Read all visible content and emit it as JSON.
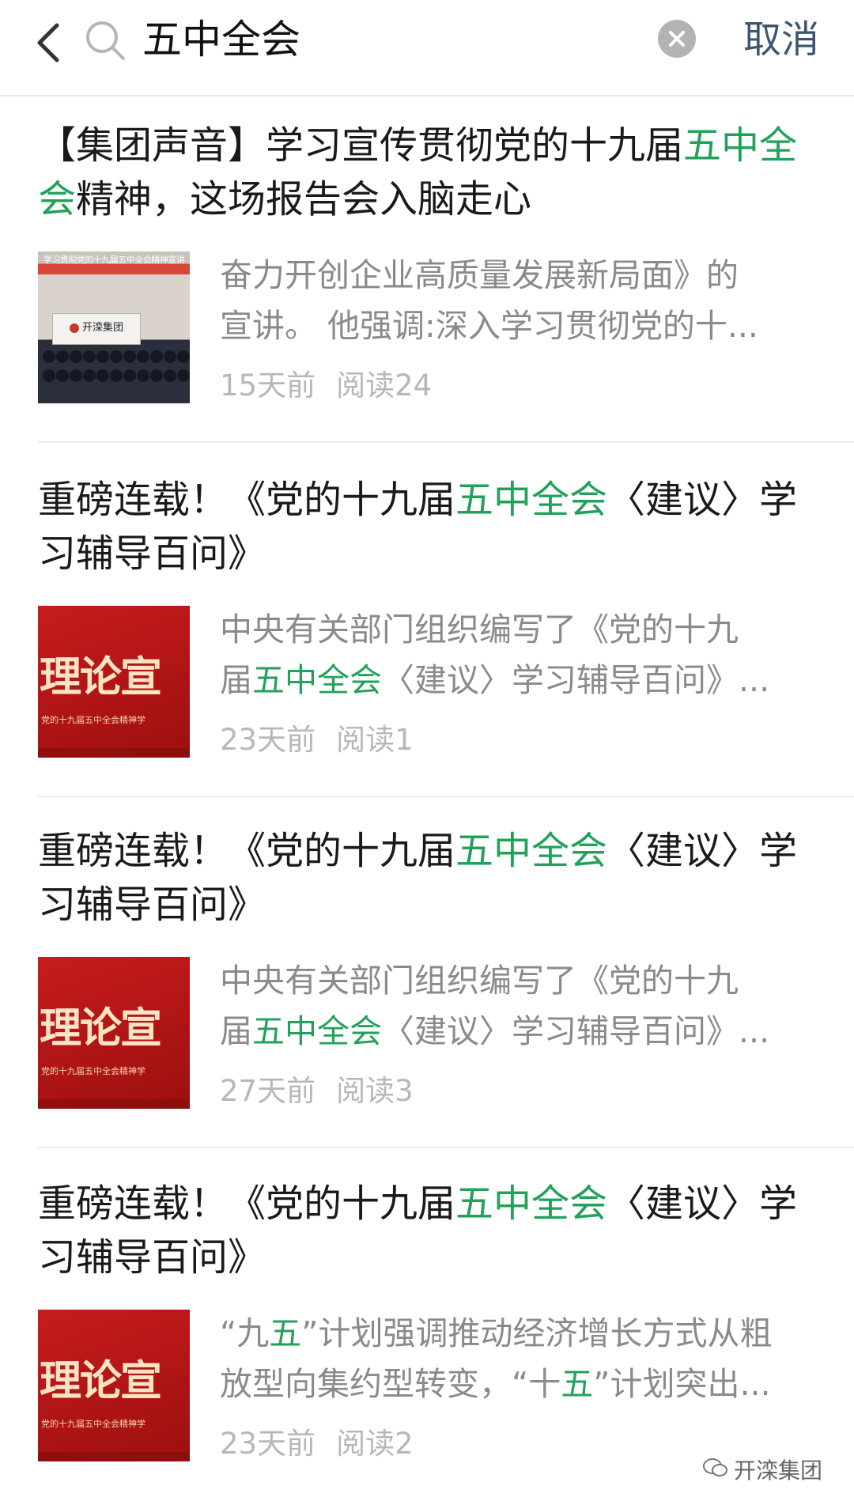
{
  "search": {
    "query": "五中全会",
    "cancel_label": "取消"
  },
  "results": [
    {
      "title": [
        {
          "text": "【集团声音】学习宣传贯彻党的十九届",
          "hl": false
        },
        {
          "text": "五中全会",
          "hl": true
        },
        {
          "text": "精神，这场报告会入脑走心",
          "hl": false
        }
      ],
      "snippet_lines": [
        [
          {
            "text": "奋力开创企业高质量发展新局面》的",
            "hl": false
          }
        ],
        [
          {
            "text": "宣讲。 他强调:深入学习贯彻党的十...",
            "hl": false
          }
        ]
      ],
      "thumb": {
        "type": "photo",
        "banner": "学习贯彻党的十九届五中全会精神宣讲",
        "sign": "开滦集团"
      },
      "time": "15天前",
      "reads": "阅读24"
    },
    {
      "title": [
        {
          "text": "重磅连载！《党的十九届",
          "hl": false
        },
        {
          "text": "五中全会",
          "hl": true
        },
        {
          "text": "〈建议〉学习辅导百问》",
          "hl": false
        }
      ],
      "snippet_lines": [
        [
          {
            "text": "中央有关部门组织编写了《党的十九",
            "hl": false
          }
        ],
        [
          {
            "text": "届",
            "hl": false
          },
          {
            "text": "五中全会",
            "hl": true
          },
          {
            "text": "〈建议〉学习辅导百问》...",
            "hl": false
          }
        ]
      ],
      "thumb": {
        "type": "red",
        "big": "理论宣",
        "small": "党的十九届五中全会精神学"
      },
      "time": "23天前",
      "reads": "阅读1"
    },
    {
      "title": [
        {
          "text": "重磅连载！《党的十九届",
          "hl": false
        },
        {
          "text": "五中全会",
          "hl": true
        },
        {
          "text": "〈建议〉学习辅导百问》",
          "hl": false
        }
      ],
      "snippet_lines": [
        [
          {
            "text": "中央有关部门组织编写了《党的十九",
            "hl": false
          }
        ],
        [
          {
            "text": "届",
            "hl": false
          },
          {
            "text": "五中全会",
            "hl": true
          },
          {
            "text": "〈建议〉学习辅导百问》...",
            "hl": false
          }
        ]
      ],
      "thumb": {
        "type": "red",
        "big": "理论宣",
        "small": "党的十九届五中全会精神学"
      },
      "time": "27天前",
      "reads": "阅读3"
    },
    {
      "title": [
        {
          "text": "重磅连载！《党的十九届",
          "hl": false
        },
        {
          "text": "五中全会",
          "hl": true
        },
        {
          "text": "〈建议〉学习辅导百问》",
          "hl": false
        }
      ],
      "snippet_lines": [
        [
          {
            "text": "“九",
            "hl": false
          },
          {
            "text": "五",
            "hl": true
          },
          {
            "text": "”计划强调推动经济增长方式从粗",
            "hl": false
          }
        ],
        [
          {
            "text": "放型向集约型转变，“十",
            "hl": false
          },
          {
            "text": "五",
            "hl": true
          },
          {
            "text": "”计划突出...",
            "hl": false
          }
        ]
      ],
      "thumb": {
        "type": "red",
        "big": "理论宣",
        "small": "党的十九届五中全会精神学"
      },
      "time": "23天前",
      "reads": "阅读2"
    }
  ],
  "watermark": "开滦集团",
  "colors": {
    "highlight": "#21a15a",
    "cancel": "#3d5570",
    "snippet": "#8a8a8a",
    "meta": "#b7b7b7"
  }
}
